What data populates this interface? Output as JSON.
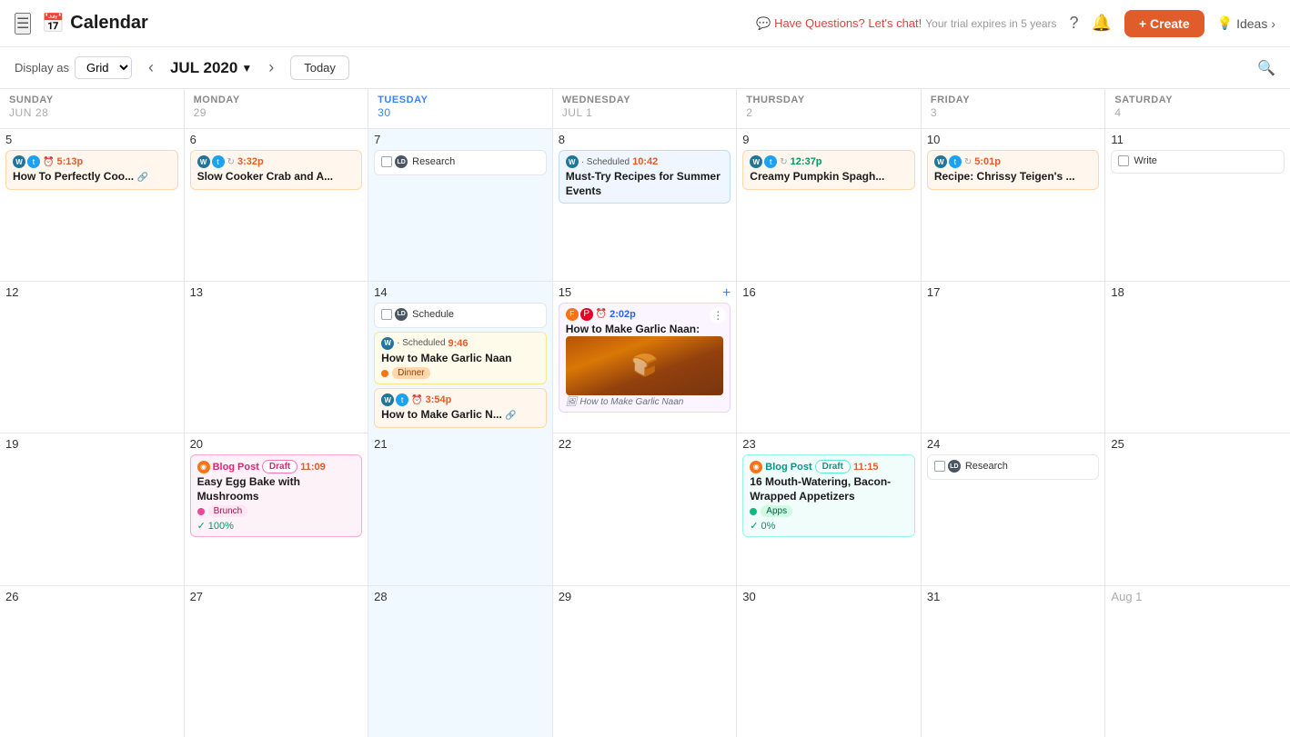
{
  "topbar": {
    "menu_icon": "☰",
    "cal_icon": "📅",
    "app_title": "Calendar",
    "trial_msg": "💬 Have Questions? Let's chat!",
    "trial_sub": "Your trial expires in 5 years",
    "help_icon": "?",
    "notif_icon": "🔔",
    "create_label": "+ Create",
    "ideas_label": "Ideas"
  },
  "subtoolbar": {
    "display_as_label": "Display as",
    "grid_label": "Grid",
    "prev_icon": "‹",
    "next_icon": "›",
    "month": "JUL 2020",
    "today_label": "Today",
    "search_icon": "🔍"
  },
  "day_headers": [
    {
      "label": "SUNDAY",
      "num": "Jun 28"
    },
    {
      "label": "MONDAY",
      "num": "29"
    },
    {
      "label": "TUESDAY",
      "num": "30"
    },
    {
      "label": "WEDNESDAY",
      "num": "Jul 1"
    },
    {
      "label": "THURSDAY",
      "num": "2"
    },
    {
      "label": "FRIDAY",
      "num": "3"
    },
    {
      "label": "SATURDAY",
      "num": "4"
    }
  ],
  "weeks": [
    {
      "days": [
        {
          "num": "5",
          "type": "normal",
          "cards": [
            {
              "type": "orange",
              "brands": [
                "wp",
                "tw"
              ],
              "time": "5:13p",
              "title": "How To Perfectly Coo...",
              "link": true
            }
          ]
        },
        {
          "num": "6",
          "type": "normal",
          "cards": [
            {
              "type": "orange",
              "brands": [
                "wp",
                "tw"
              ],
              "repeat": true,
              "time": "3:32p",
              "title": "Slow Cooker Crab and A..."
            }
          ]
        },
        {
          "num": "7",
          "type": "normal",
          "cards": [
            {
              "type": "white",
              "check": true,
              "brands": [
                "ld"
              ],
              "label": "Research"
            }
          ]
        },
        {
          "num": "8",
          "type": "normal",
          "cards": [
            {
              "type": "blue",
              "brands": [
                "wp"
              ],
              "status": "Scheduled",
              "time": "10:42",
              "time_color": "orange",
              "title": "Must-Try Recipes for Summer Events"
            }
          ]
        },
        {
          "num": "9",
          "type": "normal",
          "cards": [
            {
              "type": "orange",
              "brands": [
                "wp",
                "tw"
              ],
              "repeat": true,
              "time": "12:37p",
              "title": "Creamy Pumpkin Spagh..."
            }
          ]
        },
        {
          "num": "10",
          "type": "normal",
          "cards": [
            {
              "type": "orange",
              "brands": [
                "wp",
                "tw"
              ],
              "repeat": true,
              "time": "5:01p",
              "title": "Recipe: Chrissy Teigen's ..."
            }
          ]
        },
        {
          "num": "11",
          "type": "normal",
          "cards": [
            {
              "type": "white",
              "check": true,
              "brands": [],
              "label": "Write"
            }
          ]
        }
      ]
    },
    {
      "days": [
        {
          "num": "12",
          "type": "normal",
          "cards": []
        },
        {
          "num": "13",
          "type": "normal",
          "cards": []
        },
        {
          "num": "14",
          "type": "normal",
          "cards": [
            {
              "type": "white-sched",
              "check": true,
              "brands": [
                "ld"
              ],
              "label": "Schedule"
            },
            {
              "type": "yellow",
              "brands": [
                "wp"
              ],
              "status": "Scheduled",
              "time": "9:46",
              "time_color": "orange",
              "title": "How to Make Garlic Naan",
              "tag": "Dinner",
              "tag_type": "dinner"
            },
            {
              "type": "orange",
              "brands": [
                "wp",
                "tw"
              ],
              "time": "3:54p",
              "title": "How to Make Garlic N...",
              "link": true
            }
          ]
        },
        {
          "num": "15",
          "type": "normal",
          "plus": true,
          "cards": [
            {
              "type": "purple",
              "brands": [
                "foodtopia",
                "pt"
              ],
              "time": "2:02p",
              "title": "How to Make Garlic Naan:",
              "has_img": true,
              "img_caption": "How to Make Garlic Naan",
              "more": true
            }
          ]
        },
        {
          "num": "16",
          "type": "normal",
          "cards": []
        },
        {
          "num": "17",
          "type": "normal",
          "cards": []
        },
        {
          "num": "18",
          "type": "normal",
          "cards": []
        }
      ]
    },
    {
      "days": [
        {
          "num": "19",
          "type": "normal",
          "cards": []
        },
        {
          "num": "20",
          "type": "normal",
          "cards": [
            {
              "type": "pink",
              "blog": true,
              "draft": "Draft",
              "time": "11:09",
              "title": "Easy Egg Bake with Mushrooms",
              "tag": "Brunch",
              "tag_type": "brunch",
              "progress": "100%"
            }
          ]
        },
        {
          "num": "21",
          "type": "normal",
          "cards": []
        },
        {
          "num": "22",
          "type": "normal",
          "cards": []
        },
        {
          "num": "23",
          "type": "normal",
          "cards": [
            {
              "type": "teal",
              "blog": true,
              "draft": "Draft",
              "time": "11:15",
              "title": "16 Mouth-Watering, Bacon-Wrapped Appetizers",
              "tag": "Apps",
              "tag_type": "apps",
              "progress": "0%"
            }
          ]
        },
        {
          "num": "24",
          "type": "normal",
          "cards": [
            {
              "type": "white",
              "check": true,
              "brands": [
                "ld"
              ],
              "label": "Research"
            }
          ]
        },
        {
          "num": "25",
          "type": "normal",
          "cards": []
        }
      ]
    },
    {
      "days": [
        {
          "num": "26",
          "type": "normal",
          "cards": []
        },
        {
          "num": "27",
          "type": "normal",
          "cards": []
        },
        {
          "num": "28",
          "type": "normal",
          "cards": []
        },
        {
          "num": "29",
          "type": "normal",
          "cards": []
        },
        {
          "num": "30",
          "type": "normal",
          "cards": []
        },
        {
          "num": "31",
          "type": "normal",
          "cards": []
        },
        {
          "num": "Aug 1",
          "type": "gray",
          "cards": []
        }
      ]
    }
  ]
}
